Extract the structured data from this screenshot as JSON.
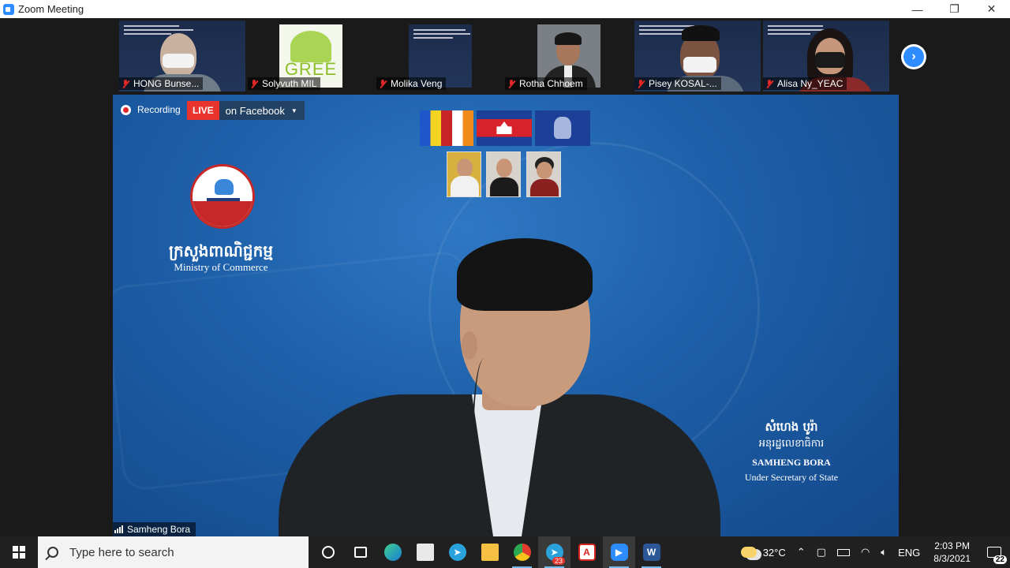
{
  "window": {
    "title": "Zoom Meeting",
    "controls": {
      "minimize": "—",
      "restore": "❐",
      "close": "✕"
    }
  },
  "participants": [
    {
      "name": "HONG Bunse...",
      "muted": true
    },
    {
      "name": "Solyvuth MIL",
      "muted": true
    },
    {
      "name": "Molika Veng",
      "muted": true
    },
    {
      "name": "Rotha Chhoem",
      "muted": true
    },
    {
      "name": "Pisey KOSAL-...",
      "muted": true
    },
    {
      "name": "Alisa Ny_YEAC",
      "muted": true
    }
  ],
  "tile_logo_text": "GREE",
  "strip_next_icon": "chevron-right-icon",
  "stage": {
    "recording_label": "Recording",
    "live_badge": "LIVE",
    "live_destination": "on Facebook",
    "ministry_khmer": "ក្រសួងពាណិជ្ជកម្ម",
    "ministry_english": "Ministry of Commerce",
    "speaker_khmer_name": "សំហេង បូរ៉ា",
    "speaker_khmer_role": "អនុរដ្ឋលេខាធិការ",
    "speaker_name": "SAMHENG BORA",
    "speaker_role": "Under Secretary of State",
    "active_speaker_label": "Samheng Bora"
  },
  "taskbar": {
    "search_placeholder": "Type here to search",
    "telegram_badge": "23",
    "weather_temp": "32°C",
    "language": "ENG",
    "time": "2:03 PM",
    "date": "8/3/2021",
    "notification_count": "22"
  }
}
